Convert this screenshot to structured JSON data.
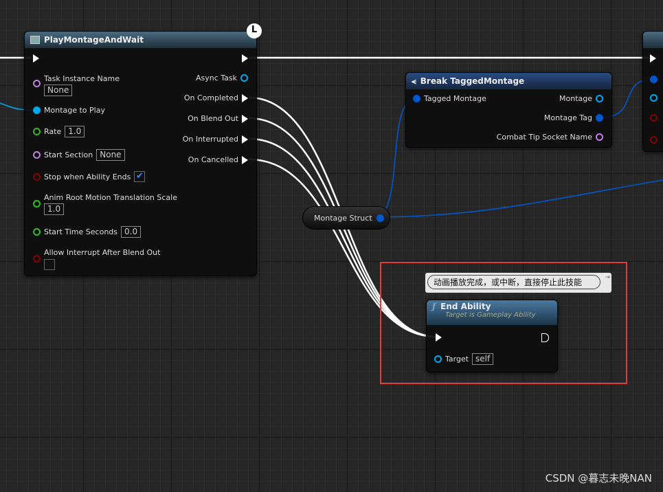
{
  "play_montage_node": {
    "title": "PlayMontageAndWait",
    "inputs": [
      {
        "label": "Task Instance Name",
        "value": "None",
        "pin": "name"
      },
      {
        "label": "Montage to Play",
        "pin": "object"
      },
      {
        "label": "Rate",
        "value": "1.0",
        "pin": "float"
      },
      {
        "label": "Start Section",
        "value": "None",
        "pin": "name"
      },
      {
        "label": "Stop when Ability Ends",
        "checked": true,
        "pin": "bool"
      },
      {
        "label": "Anim Root Motion Translation Scale",
        "value": "1.0",
        "pin": "float"
      },
      {
        "label": "Start Time Seconds",
        "value": "0.0",
        "pin": "float"
      },
      {
        "label": "Allow Interrupt After Blend Out",
        "checked": false,
        "pin": "bool"
      }
    ],
    "outputs": [
      "Async Task",
      "On Completed",
      "On Blend Out",
      "On Interrupted",
      "On Cancelled"
    ]
  },
  "break_node": {
    "title": "Break TaggedMontage",
    "input": "Tagged Montage",
    "outputs": [
      "Montage",
      "Montage Tag",
      "Combat Tip Socket Name"
    ]
  },
  "reroute_node": {
    "label": "Montage Struct"
  },
  "comment": {
    "text": "动画播放完成，或中断，直接停止此技能"
  },
  "end_ability_node": {
    "title": "End Ability",
    "subtitle": "Target is Gameplay Ability",
    "target_label": "Target",
    "target_value": "self"
  },
  "watermark": "CSDN @暮志未晚NAN",
  "colors": {
    "exec": "#ffffff",
    "object": "#00a8f0",
    "struct": "#0058d0",
    "name": "#c080e0",
    "float": "#30c020",
    "bool": "#8a0000",
    "highlight": "#e83a3a"
  }
}
